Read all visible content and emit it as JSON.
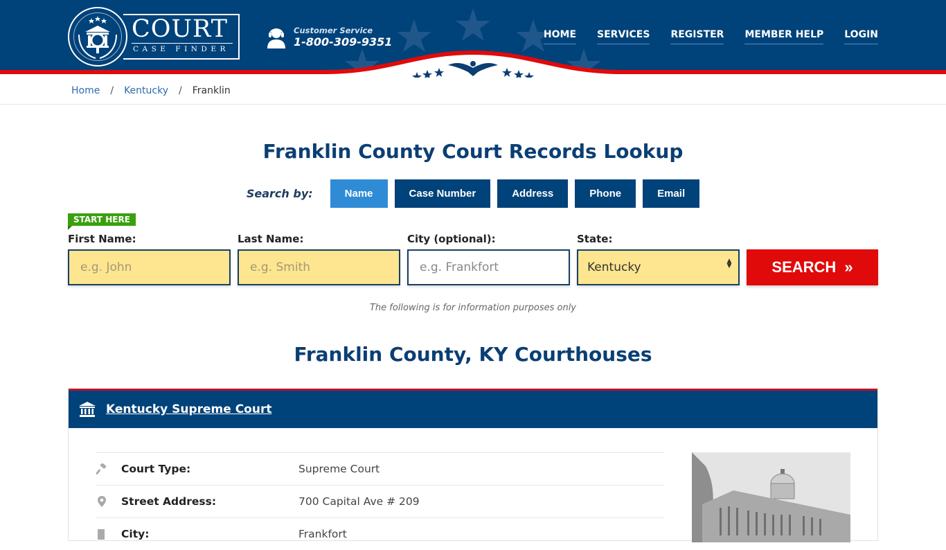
{
  "header": {
    "logo": {
      "title": "COURT",
      "subtitle": "CASE FINDER"
    },
    "customer_service": {
      "label": "Customer Service",
      "phone": "1-800-309-9351"
    },
    "nav": [
      {
        "label": "HOME"
      },
      {
        "label": "SERVICES"
      },
      {
        "label": "REGISTER"
      },
      {
        "label": "MEMBER HELP"
      },
      {
        "label": "LOGIN"
      }
    ]
  },
  "breadcrumb": [
    {
      "label": "Home"
    },
    {
      "label": "Kentucky"
    },
    {
      "label": "Franklin"
    }
  ],
  "page_title": "Franklin County Court Records Lookup",
  "search_by": {
    "label": "Search by:",
    "tabs": [
      {
        "label": "Name",
        "active": true
      },
      {
        "label": "Case Number"
      },
      {
        "label": "Address"
      },
      {
        "label": "Phone"
      },
      {
        "label": "Email"
      }
    ]
  },
  "form": {
    "badge": "START HERE",
    "first_name": {
      "label": "First Name:",
      "placeholder": "e.g. John"
    },
    "last_name": {
      "label": "Last Name:",
      "placeholder": "e.g. Smith"
    },
    "city": {
      "label": "City (optional):",
      "placeholder": "e.g.  Frankfort"
    },
    "state": {
      "label": "State:",
      "value": "Kentucky"
    },
    "search_label": "SEARCH",
    "search_icon": "double-chevron-right"
  },
  "disclaimer": "The following is for information purposes only",
  "courthouses_title": "Franklin County, KY Courthouses",
  "court": {
    "name": "Kentucky Supreme Court",
    "rows": [
      {
        "icon": "gavel-icon",
        "label": "Court Type:",
        "value": "Supreme Court"
      },
      {
        "icon": "map-pin-icon",
        "label": "Street Address:",
        "value": "700 Capital Ave # 209"
      },
      {
        "icon": "building-icon",
        "label": "City:",
        "value": "Frankfort"
      }
    ],
    "photo_alt": "courthouse-photo"
  },
  "colors": {
    "primary": "#00427a",
    "accent_blue": "#2f8bd5",
    "accent_red": "#e10a0a",
    "input_yellow": "#fde68f",
    "badge_green": "#3aa00e"
  }
}
